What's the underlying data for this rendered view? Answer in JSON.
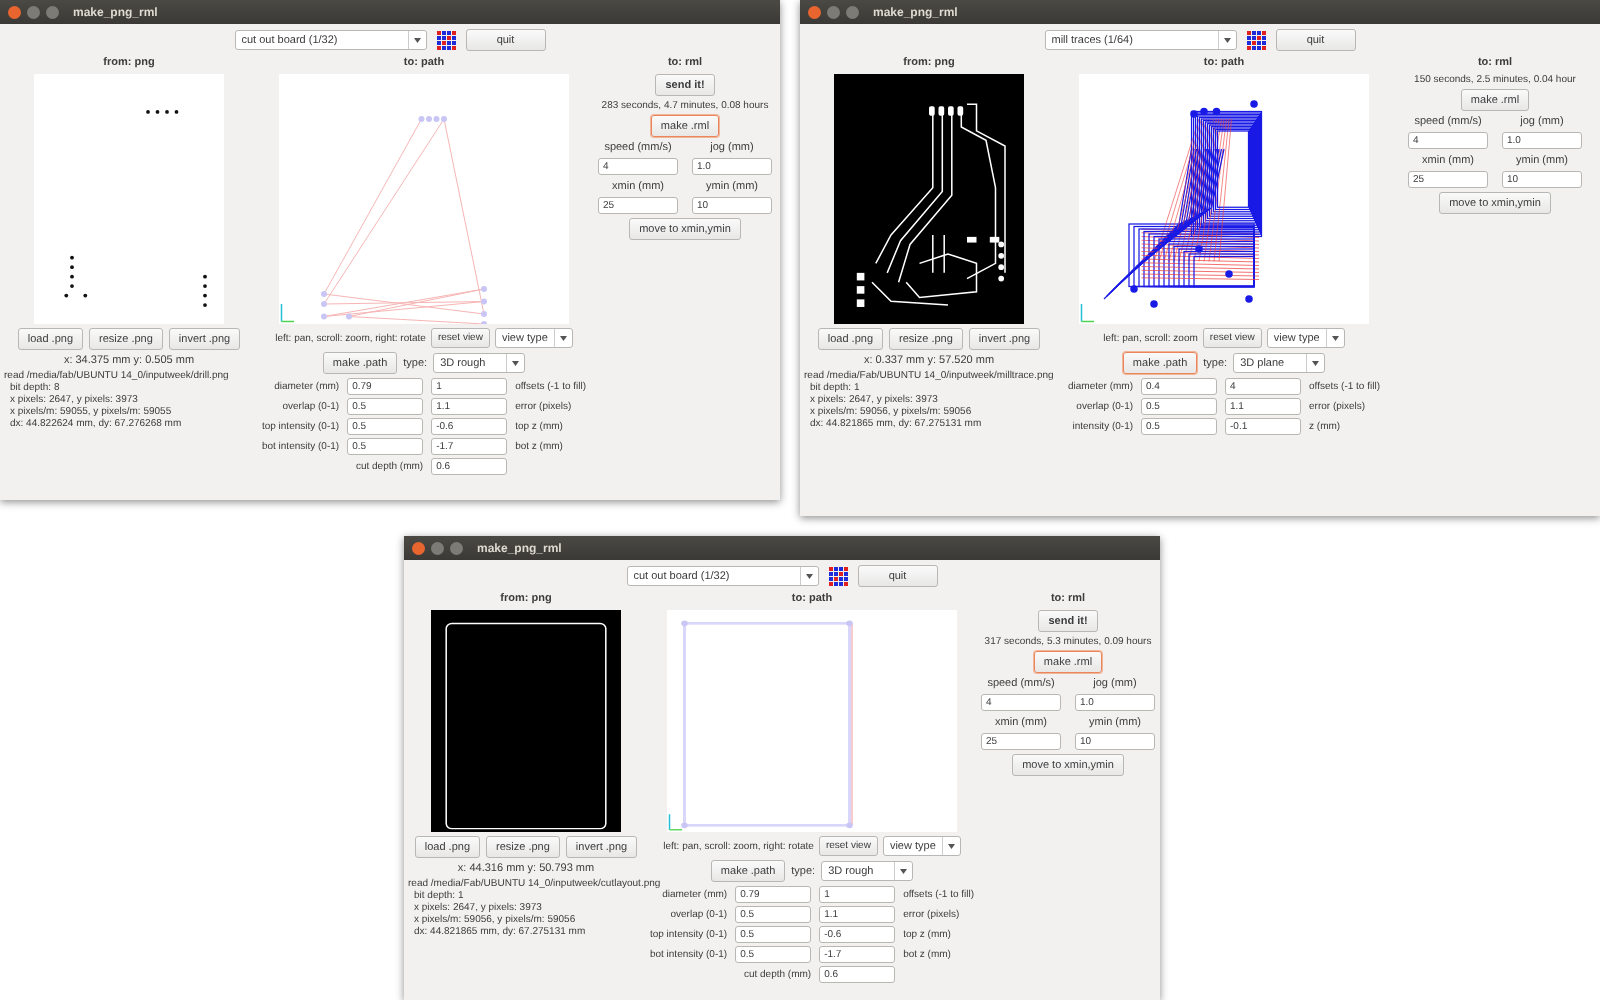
{
  "windows": [
    {
      "kind": "drill",
      "title": "make_png_rml",
      "machine": "cut out board (1/32)",
      "quit": "quit",
      "from_label": "from: png",
      "path_label": "to: path",
      "rml_label": "to: rml",
      "send": "send it!",
      "estimate": "283 seconds, 4.7 minutes, 0.08 hours",
      "make_rml": {
        "label": "make .rml",
        "focused": true
      },
      "settings": [
        {
          "label": "speed (mm/s)",
          "value": "4"
        },
        {
          "label": "jog (mm)",
          "value": "1.0"
        },
        {
          "label": "xmin (mm)",
          "value": "25"
        },
        {
          "label": "ymin (mm)",
          "value": "10"
        }
      ],
      "move": "move to xmin,ymin",
      "file_buttons": [
        "load .png",
        "resize .png",
        "invert .png"
      ],
      "coords": "x: 34.375 mm  y: 0.505 mm",
      "info": [
        "read /media/fab/UBUNTU 14_0/inputweek/drill.png",
        "bit depth: 8",
        "x pixels: 2647, y pixels: 3973",
        "x pixels/m: 59055, y pixels/m: 59055",
        "dx: 44.822624 mm, dy: 67.276268 mm"
      ],
      "hint": "left: pan, scroll: zoom, right: rotate",
      "reset_view": "reset view",
      "view_type": "view type",
      "make_path": {
        "label": "make .path",
        "focused": false
      },
      "type_label": "type:",
      "type": "3D rough",
      "params": [
        {
          "label": "diameter (mm)",
          "value": "0.79",
          "value_2": "1",
          "label_2": "offsets (-1 to fill)"
        },
        {
          "label": "overlap (0-1)",
          "value": "0.5",
          "value_2": "1.1",
          "label_2": "error (pixels)"
        },
        {
          "label": "top intensity (0-1)",
          "value": "0.5",
          "value_2": "-0.6",
          "label_2": "top z (mm)"
        },
        {
          "label": "bot intensity (0-1)",
          "value": "0.5",
          "value_2": "-1.7",
          "label_2": "bot z (mm)"
        },
        {
          "label": "cut depth (mm)",
          "value": "0.6"
        }
      ]
    },
    {
      "kind": "traces",
      "title": "make_png_rml",
      "machine": "mill traces (1/64)",
      "quit": "quit",
      "from_label": "from: png",
      "path_label": "to: path",
      "rml_label": "to: rml",
      "estimate": "150 seconds, 2.5 minutes, 0.04 hour",
      "make_rml": {
        "label": "make .rml",
        "focused": false
      },
      "settings": [
        {
          "label": "speed (mm/s)",
          "value": "4"
        },
        {
          "label": "jog (mm)",
          "value": "1.0"
        },
        {
          "label": "xmin (mm)",
          "value": "25"
        },
        {
          "label": "ymin (mm)",
          "value": "10"
        }
      ],
      "move": "move to xmin,ymin",
      "file_buttons": [
        "load .png",
        "resize .png",
        "invert .png"
      ],
      "coords": "x: 0.337 mm  y: 57.520 mm",
      "info": [
        "read /media/Fab/UBUNTU 14_0/inputweek/milltrace.png",
        "bit depth: 1",
        "x pixels: 2647, y pixels: 3973",
        "x pixels/m: 59056, y pixels/m: 59056",
        "dx: 44.821865 mm, dy: 67.275131 mm"
      ],
      "hint": "left: pan, scroll: zoom",
      "reset_view": "reset view",
      "view_type": "view type",
      "make_path": {
        "label": "make .path",
        "focused": true
      },
      "type_label": "type:",
      "type": "3D plane",
      "params": [
        {
          "label": "diameter (mm)",
          "value": "0.4",
          "value_2": "4",
          "label_2": "offsets (-1 to fill)"
        },
        {
          "label": "overlap (0-1)",
          "value": "0.5",
          "value_2": "1.1",
          "label_2": "error (pixels)"
        },
        {
          "label": "intensity (0-1)",
          "value": "0.5",
          "value_2": "-0.1",
          "label_2": "z (mm)"
        }
      ]
    },
    {
      "kind": "outline",
      "title": "make_png_rml",
      "machine": "cut out board (1/32)",
      "quit": "quit",
      "from_label": "from: png",
      "path_label": "to: path",
      "rml_label": "to: rml",
      "send": "send it!",
      "estimate": "317 seconds, 5.3 minutes, 0.09 hours",
      "make_rml": {
        "label": "make .rml",
        "focused": true
      },
      "settings": [
        {
          "label": "speed (mm/s)",
          "value": "4"
        },
        {
          "label": "jog (mm)",
          "value": "1.0"
        },
        {
          "label": "xmin (mm)",
          "value": "25"
        },
        {
          "label": "ymin (mm)",
          "value": "10"
        }
      ],
      "move": "move to xmin,ymin",
      "file_buttons": [
        "load .png",
        "resize .png",
        "invert .png"
      ],
      "coords": "x: 44.316 mm  y: 50.793 mm",
      "info": [
        "read /media/Fab/UBUNTU 14_0/inputweek/cutlayout.png",
        "bit depth: 1",
        "x pixels: 2647, y pixels: 3973",
        "x pixels/m: 59056, y pixels/m: 59056",
        "dx: 44.821865 mm, dy: 67.275131 mm"
      ],
      "hint": "left: pan, scroll: zoom, right: rotate",
      "reset_view": "reset view",
      "view_type": "view type",
      "make_path": {
        "label": "make .path",
        "focused": false
      },
      "type_label": "type:",
      "type": "3D rough",
      "params": [
        {
          "label": "diameter (mm)",
          "value": "0.79",
          "value_2": "1",
          "label_2": "offsets (-1 to fill)"
        },
        {
          "label": "overlap (0-1)",
          "value": "0.5",
          "value_2": "1.1",
          "label_2": "error (pixels)"
        },
        {
          "label": "top intensity (0-1)",
          "value": "0.5",
          "value_2": "-0.6",
          "label_2": "top z (mm)"
        },
        {
          "label": "bot intensity (0-1)",
          "value": "0.5",
          "value_2": "-1.7",
          "label_2": "bot z (mm)"
        },
        {
          "label": "cut depth (mm)",
          "value": "0.6"
        }
      ]
    }
  ]
}
